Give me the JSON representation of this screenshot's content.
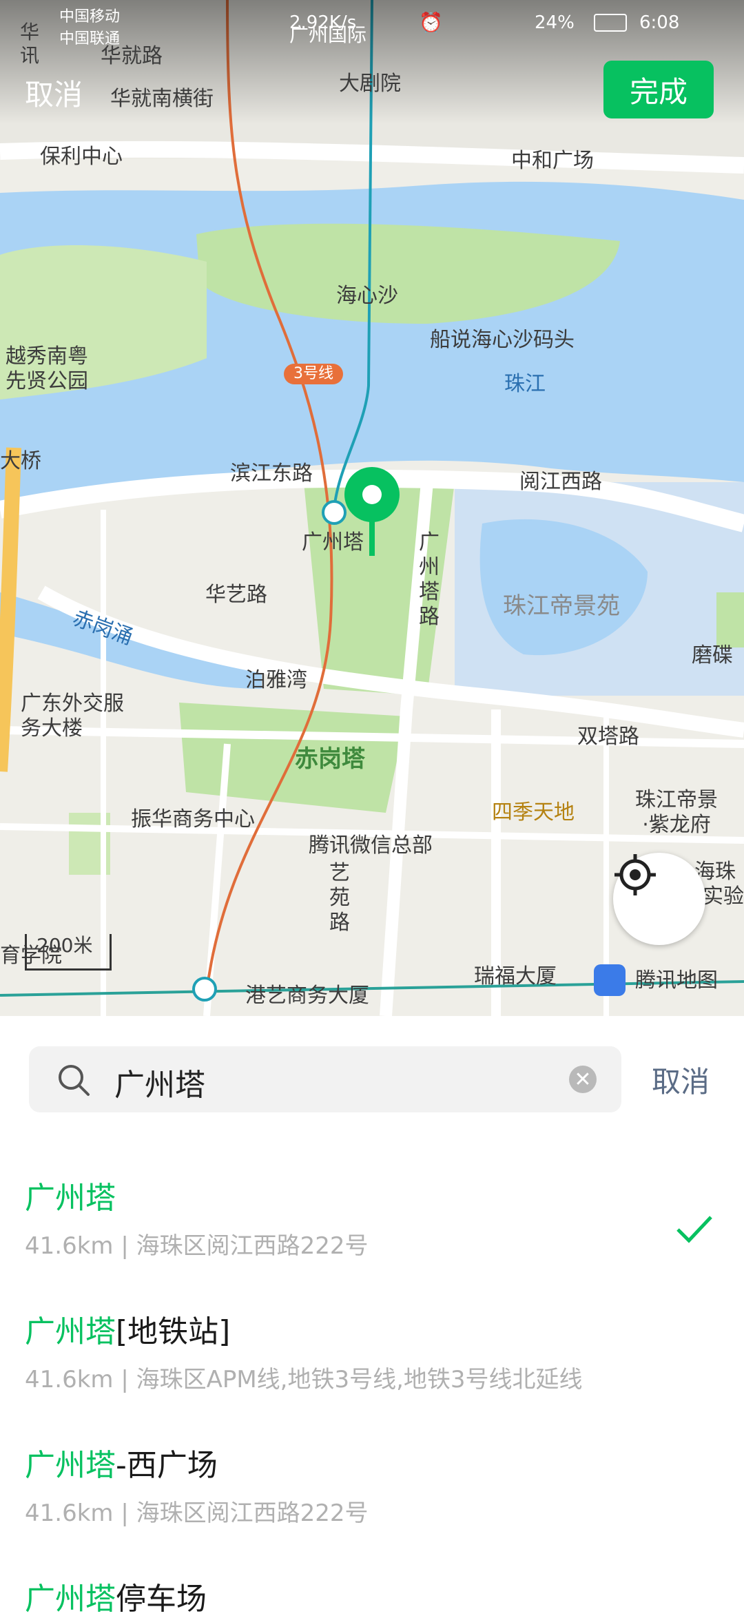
{
  "status_bar": {
    "carrier1": "中国移动",
    "carrier2": "中国联通",
    "speed": "2.92K/s",
    "battery": "24%",
    "time": "6:08"
  },
  "header": {
    "cancel_label": "取消",
    "done_label": "完成",
    "accent": "#07c160"
  },
  "map": {
    "labels": {
      "huaxun": "华讯",
      "huajiulu": "华就路",
      "huajiunanheng": "华就南横街",
      "baolizhongxin": "保利中心",
      "dajuyuan": "大剧院",
      "guangzhouguoji": "广州国际",
      "zhonghe": "中和广场",
      "haixinsha": "海心沙",
      "chuanshuo": "船说海心沙码头",
      "zhujiang": "珠江",
      "yuexiu": "越秀南粤先贤公园",
      "line3": "3号线",
      "daqiao": "大桥",
      "binjiang": "滨江东路",
      "yuejiang": "阅江西路",
      "guangzhouta": "广州塔",
      "guangzhoutalu": "广州塔路",
      "huayi": "华艺路",
      "chigangyong": "赤岗涌",
      "zhujiangdijing": "珠江帝景苑",
      "moshi": "磨碟",
      "boyawan": "泊雅湾",
      "guangdongwaijiao": "广东外交服务大楼",
      "chigangta": "赤岗塔",
      "shuangta": "双塔路",
      "zhenhua": "振华商务中心",
      "sijitiandi": "四季天地",
      "zhujiangdijingzilong": "珠江帝景·紫龙府",
      "tengxun": "腾讯微信总部",
      "yiyuan": "艺苑路",
      "haizhu": "海珠",
      "shiyan": "实验",
      "yuxueyuan": "育学院",
      "scale": "200米",
      "ruifu": "瑞福大厦",
      "gangyi": "港艺商务大厦",
      "tencent_map": "腾讯地图"
    }
  },
  "search": {
    "value": "广州塔",
    "cancel_label": "取消"
  },
  "results": [
    {
      "highlight": "广州塔",
      "rest": "",
      "sub": "41.6km | 海珠区阅江西路222号",
      "selected": true
    },
    {
      "highlight": "广州塔",
      "rest": "[地铁站]",
      "sub": "41.6km | 海珠区APM线,地铁3号线,地铁3号线北延线",
      "selected": false
    },
    {
      "highlight": "广州塔",
      "rest": "-西广场",
      "sub": "41.6km | 海珠区阅江西路222号",
      "selected": false
    },
    {
      "highlight": "广州塔",
      "rest": "停车场",
      "sub": "",
      "selected": false
    }
  ]
}
